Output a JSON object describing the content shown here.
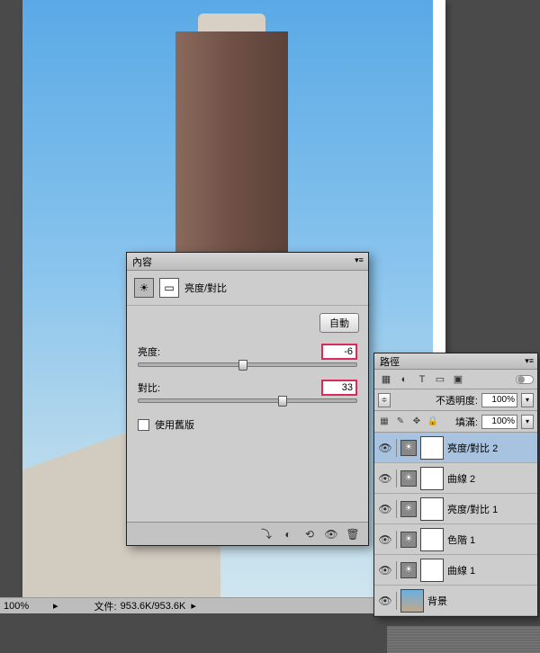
{
  "status": {
    "zoom": "100%",
    "file_label": "文件:",
    "file_info": "953.6K/953.6K"
  },
  "panel": {
    "title": "內容",
    "adjName": "亮度/對比",
    "autoBtn": "自動",
    "brightnessLabel": "亮度:",
    "brightnessValue": "-6",
    "contrastLabel": "對比:",
    "contrastValue": "33",
    "legacyLabel": "使用舊版"
  },
  "layers": {
    "tab": "路徑",
    "opacityLabel": "不透明度:",
    "opacityValue": "100%",
    "fillLabel": "填滿:",
    "fillValue": "100%",
    "items": [
      {
        "name": "亮度/對比 2",
        "selected": true,
        "type": "adj"
      },
      {
        "name": "曲線 2",
        "selected": false,
        "type": "adj"
      },
      {
        "name": "亮度/對比 1",
        "selected": false,
        "type": "adj"
      },
      {
        "name": "色階 1",
        "selected": false,
        "type": "adj"
      },
      {
        "name": "曲線 1",
        "selected": false,
        "type": "adj"
      },
      {
        "name": "背景",
        "selected": false,
        "type": "bg"
      }
    ]
  }
}
